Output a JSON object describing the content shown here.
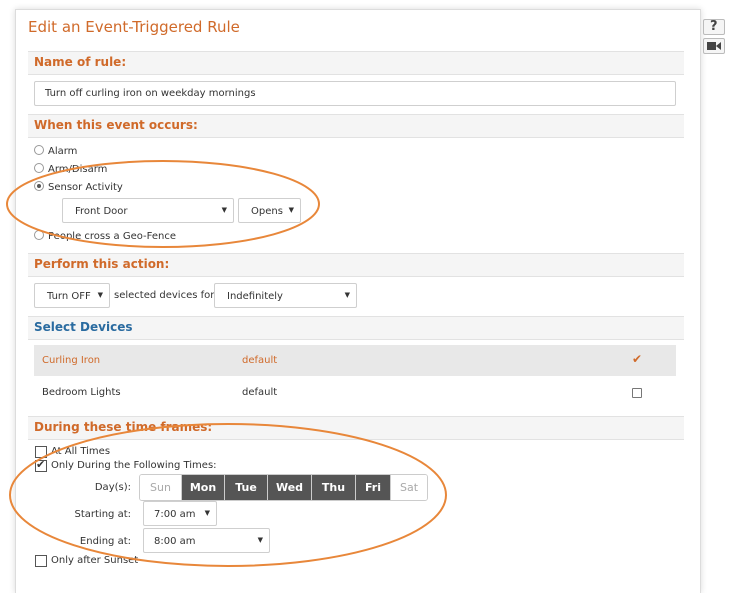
{
  "title": "Edit an Event-Triggered Rule",
  "name_section": {
    "heading": "Name of rule:",
    "value": "Turn off curling iron on weekday mornings"
  },
  "event_section": {
    "heading": "When this event occurs:",
    "options": [
      "Alarm",
      "Arm/Disarm",
      "Sensor Activity",
      "People cross a Geo-Fence"
    ],
    "selected": "Sensor Activity",
    "sensor_select": "Front Door",
    "action_select": "Opens"
  },
  "action_section": {
    "heading": "Perform this action:",
    "action_select": "Turn OFF",
    "middle_text": "selected devices for",
    "duration_select": "Indefinitely"
  },
  "devices_section": {
    "heading": "Select Devices",
    "rows": [
      {
        "name": "Curling Iron",
        "setting": "default",
        "selected": true
      },
      {
        "name": "Bedroom Lights",
        "setting": "default",
        "selected": false
      }
    ]
  },
  "time_section": {
    "heading": "During these time frames:",
    "all_times_label": "At All Times",
    "following_label": "Only During the Following Times:",
    "days_label": "Day(s):",
    "days": [
      {
        "label": "Sun",
        "on": false
      },
      {
        "label": "Mon",
        "on": true
      },
      {
        "label": "Tue",
        "on": true
      },
      {
        "label": "Wed",
        "on": true
      },
      {
        "label": "Thu",
        "on": true
      },
      {
        "label": "Fri",
        "on": true
      },
      {
        "label": "Sat",
        "on": false
      }
    ],
    "starting_label": "Starting at:",
    "starting_value": "7:00 am",
    "ending_label": "Ending at:",
    "ending_value": "8:00 am",
    "sunset_label": "Only after Sunset"
  },
  "side_buttons": {
    "help_icon": "question-mark-icon",
    "video_icon": "video-camera-icon"
  },
  "colors": {
    "accent": "#d06a2a",
    "heading_blue": "#2a6ba0",
    "annotation": "#e8873a",
    "selected_day": "#555555"
  }
}
